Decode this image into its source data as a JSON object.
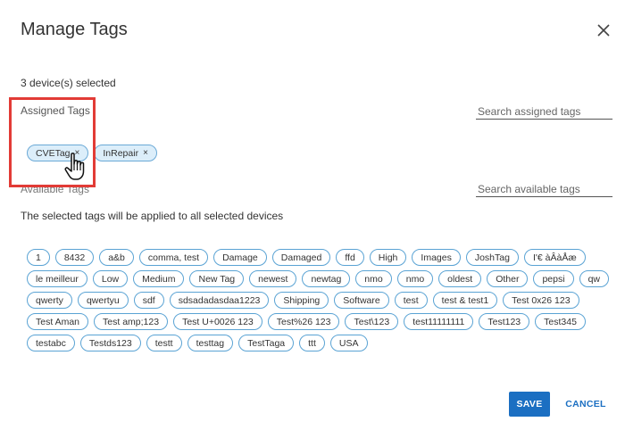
{
  "dialog": {
    "title": "Manage Tags",
    "devices_selected": "3 device(s) selected",
    "assigned": {
      "label": "Assigned Tags",
      "search_placeholder": "Search assigned tags",
      "tags": [
        "CVETag",
        "InRepair"
      ]
    },
    "available": {
      "label": "Available Tags",
      "search_placeholder": "Search available tags",
      "instructions": "The selected tags will be applied to all selected devices",
      "tags": [
        "1",
        "8432",
        "a&b",
        "comma, test",
        "Damage",
        "Damaged",
        "ffd",
        "High",
        "Images",
        "JoshTag",
        "I'€ àÂàÅæ",
        "le meilleur",
        "Low",
        "Medium",
        "New Tag",
        "newest",
        "newtag",
        "nmo",
        "nmo",
        "oldest",
        "Other",
        "pepsi",
        "qw",
        "qwerty",
        "qwertyu",
        "sdf",
        "sdsadadasdaa1223",
        "Shipping",
        "Software",
        "test",
        "test & test1",
        "Test 0x26 123",
        "Test Aman",
        "Test amp;123",
        "Test U+0026 123",
        "Test%26 123",
        "Test\\123",
        "test11111111",
        "Test123",
        "Test345",
        "testabc",
        "Testds123",
        "testt",
        "testtag",
        "TestTaga",
        "ttt",
        "USA"
      ]
    },
    "buttons": {
      "save": "SAVE",
      "cancel": "CANCEL"
    },
    "remove_glyph": "×",
    "colors": {
      "accent": "#1b6fc2",
      "chip_border": "#5aa3d4",
      "chip_assigned_bg": "#dceefa",
      "highlight": "#e23b36"
    }
  }
}
